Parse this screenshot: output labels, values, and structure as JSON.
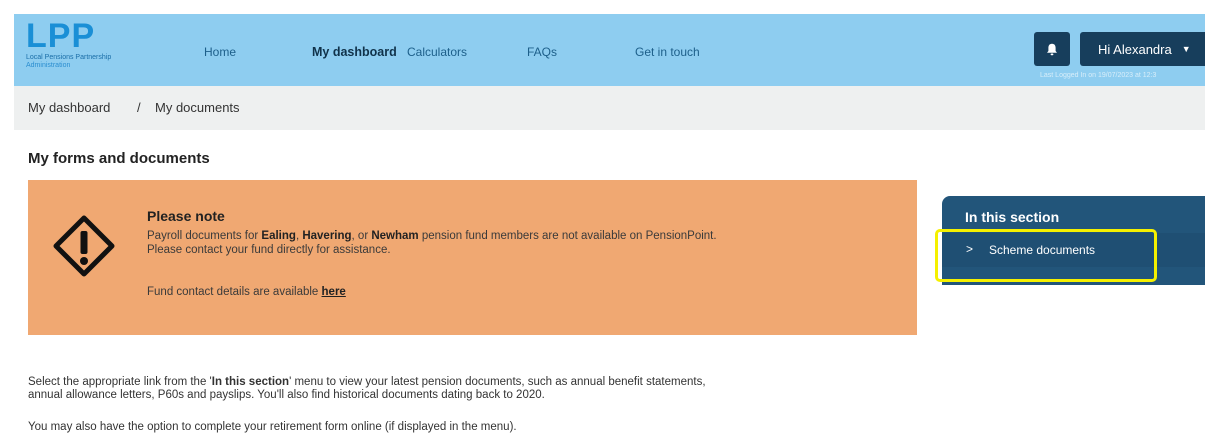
{
  "header": {
    "logo": {
      "mark": "LPP",
      "subtitle_line1": "Local Pensions Partnership",
      "subtitle_line2": "Administration"
    },
    "nav": [
      {
        "label": "Home",
        "active": false
      },
      {
        "label": "My dashboard",
        "active": true
      },
      {
        "label": "Calculators",
        "active": false
      },
      {
        "label": "FAQs",
        "active": false
      },
      {
        "label": "Get in touch",
        "active": false
      }
    ],
    "notification_icon": "bell-icon",
    "user_menu": {
      "label": "Hi Alexandra",
      "icon": "caret-down-icon"
    },
    "last_login": "Last Logged In on 19/07/2023 at 12:3"
  },
  "breadcrumb": {
    "items": [
      "My dashboard",
      "My documents"
    ],
    "separator": "/"
  },
  "page_title": "My forms and documents",
  "notice": {
    "icon": "warning-diamond-icon",
    "title": "Please note",
    "text_prefix": "Payroll documents for ",
    "fund1": "Ealing",
    "sep1": ", ",
    "fund2": "Havering",
    "sep2": ", or ",
    "fund3": "Newham",
    "text_suffix": " pension fund members are not available on PensionPoint.",
    "line2": "Please contact your fund directly for assistance.",
    "contact_prefix": "Fund contact details are available ",
    "contact_link": "here"
  },
  "sidebar": {
    "title": "In this section",
    "items": [
      {
        "label": "Scheme documents",
        "icon": "chevron-right-icon"
      }
    ]
  },
  "body": {
    "p1_prefix": "Select the appropriate link from the '",
    "p1_bold": "In this section",
    "p1_suffix": "' menu to view your latest pension documents, such as annual benefit statements,",
    "p1_line2": "annual allowance letters, P60s and payslips. You'll also find historical documents dating back to 2020.",
    "p2": "You may also have the option to complete your retirement form online (if displayed in the menu)."
  },
  "colors": {
    "header_bg": "#8ecdf0",
    "button_dark": "#173e5c",
    "notice_bg": "#f0a872",
    "sidebar_bg": "#22557a",
    "highlight": "#f5f000"
  }
}
